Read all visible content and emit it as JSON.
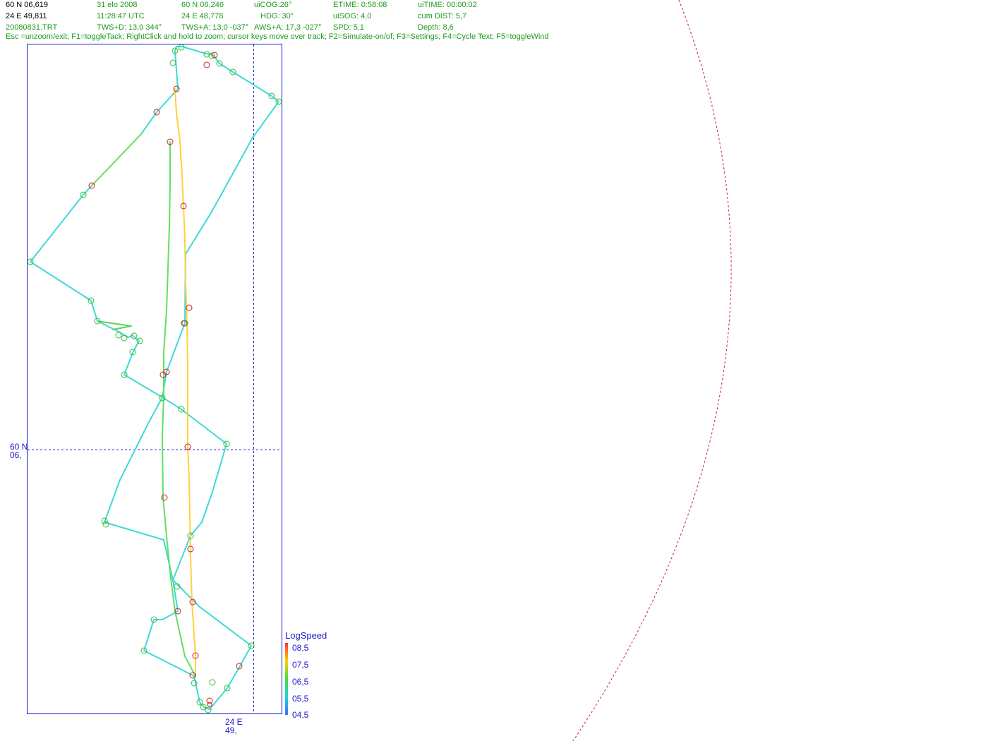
{
  "header": {
    "row1": [
      "60 N 06,619",
      "31 elo 2008",
      "60 N 06,246",
      "uiCOG:26°",
      "ETIME: 0:58:08",
      "uiTIME: 00:00:02"
    ],
    "row2": [
      "24 E 49,811",
      "11:28:47  UTC",
      "24 E 48,778",
      "HDG: 30°",
      "uiSOG: 4,0",
      "cum DIST: 5,7"
    ],
    "row3": [
      "20080831.TRT",
      "TWS+D: 13,0 344°",
      "TWS+A: 13,0 -037°",
      "AWS+A: 17,3 -027°",
      "SPD: 5,1",
      "Depth: 8,6"
    ],
    "help": "Esc =unzoom/exit; F1=toggleTack; RightClick and hold to zoom; cursor keys move over track; F2=Simulate-on/of; F3=Settings; F4=Cycle Text; F5=toggleWind"
  },
  "axes": {
    "lat_label_1": "60 N",
    "lat_label_2": "06,",
    "lon_label_1": "24 E",
    "lon_label_2": "49,"
  },
  "legend": {
    "title": "LogSpeed",
    "labels": [
      "08,5",
      "07,5",
      "06,5",
      "05,5",
      "04,5"
    ]
  },
  "colors": {
    "frame": "#1a1acc",
    "track": "#40d8d8",
    "green_marker": "#30c030",
    "red_marker": "#d02020",
    "range_circle": "#cc2020"
  }
}
